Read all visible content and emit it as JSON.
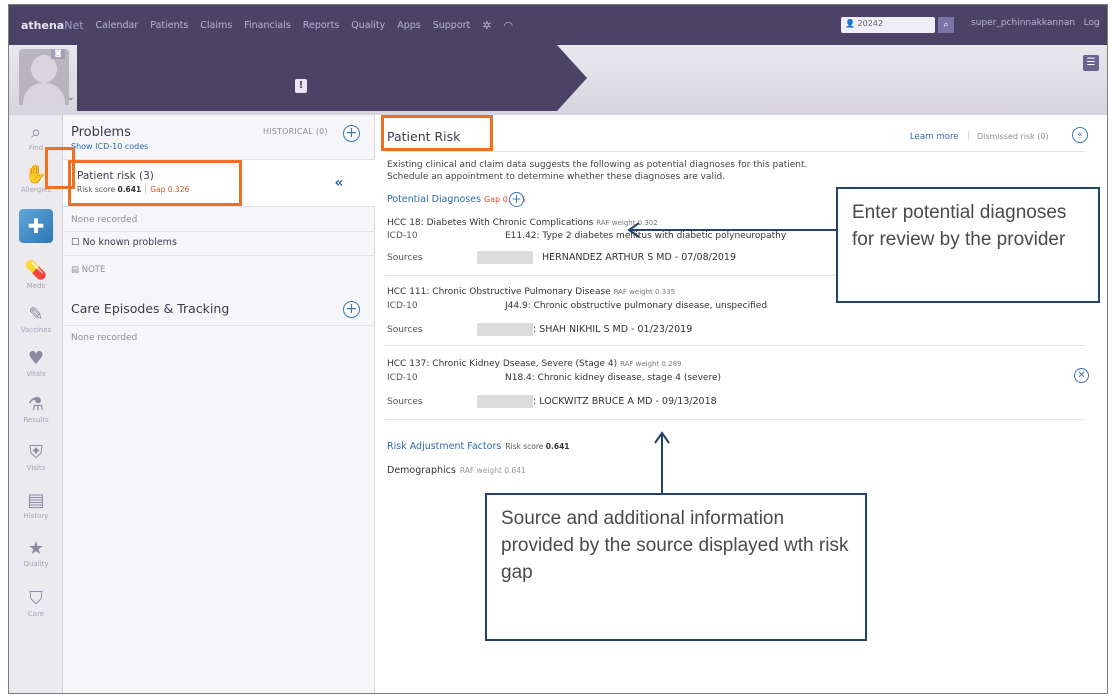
{
  "topnav": {
    "logo_prefix": "athena",
    "logo_suffix": "Net",
    "items": [
      "Calendar",
      "Patients",
      "Claims",
      "Financials",
      "Reports",
      "Quality",
      "Apps",
      "Support"
    ],
    "search_value": "20242",
    "user": "super_pchinnakkannan",
    "logout": "Log"
  },
  "problems": {
    "title": "Problems",
    "link": "Show ICD-10 codes",
    "historical": "HISTORICAL (0)",
    "risk_title": "Patient risk (3)",
    "risk_score_label": "Risk score",
    "risk_score": "0.641",
    "gap_label": "Gap 0.326",
    "none_recorded": "None recorded",
    "no_known": "No known problems",
    "note": "NOTE",
    "care_title": "Care Episodes & Tracking",
    "care_none": "None recorded"
  },
  "rail": [
    {
      "label": "Find",
      "icon": "find-icon"
    },
    {
      "label": "Allergies",
      "icon": "allergies-icon"
    },
    {
      "label": "",
      "icon": "problems-icon"
    },
    {
      "label": "Meds",
      "icon": "meds-icon"
    },
    {
      "label": "Vaccines",
      "icon": "vaccines-icon"
    },
    {
      "label": "Vitals",
      "icon": "vitals-icon"
    },
    {
      "label": "Results",
      "icon": "results-icon"
    },
    {
      "label": "Visits",
      "icon": "visits-icon"
    },
    {
      "label": "History",
      "icon": "history-icon"
    },
    {
      "label": "Quality",
      "icon": "quality-icon"
    },
    {
      "label": "Care",
      "icon": "care-icon"
    }
  ],
  "risk": {
    "title": "Patient Risk",
    "learn_more": "Learn more",
    "dismissed": "Dismissed risk (0)",
    "intro1": "Existing clinical and claim data suggests the following as potential diagnoses for this patient.",
    "intro2": "Schedule an appointment to determine whether these diagnoses are valid.",
    "potential_label": "Potential Diagnoses",
    "potential_gap": "Gap 0.326",
    "icd_label": "ICD-10",
    "sources_label": "Sources",
    "hccs": [
      {
        "code": "HCC 18:",
        "name": "Diabetes With Chronic Complications",
        "raf": "RAF weight 0.302",
        "icd": "E11.42: Type 2 diabetes mellitus with diabetic polyneuropathy",
        "source": "HERNANDEZ ARTHUR S MD - 07/08/2019"
      },
      {
        "code": "HCC 111:",
        "name": "Chronic Obstructive Pulmonary Disease",
        "raf": "RAF weight 0.335",
        "icd": "J44.9: Chronic obstructive pulmonary disease, unspecified",
        "source": ": SHAH NIKHIL S MD - 01/23/2019"
      },
      {
        "code": "HCC 137:",
        "name": "Chronic Kidney Dsease, Severe (Stage 4)",
        "raf": "RAF weight 0.289",
        "icd": "N18.4: Chronic kidney disease, stage 4 (severe)",
        "source": ": LOCKWITZ BRUCE A MD - 09/13/2018"
      }
    ],
    "raf_title": "Risk Adjustment Factors",
    "raf_score_label": "Risk score",
    "raf_score": "0.641",
    "demographics": "Demographics",
    "demographics_weight": "RAF weight 0.641"
  },
  "callouts": {
    "right": "Enter potential diagnoses for review by the provider",
    "bottom": "Source and additional information provided by the source displayed wth risk gap"
  },
  "colors": {
    "nav": "#4a4366",
    "highlight": "#f07020",
    "callout_border": "#23436b",
    "link": "#2d6aa8",
    "gap": "#e0542a"
  }
}
